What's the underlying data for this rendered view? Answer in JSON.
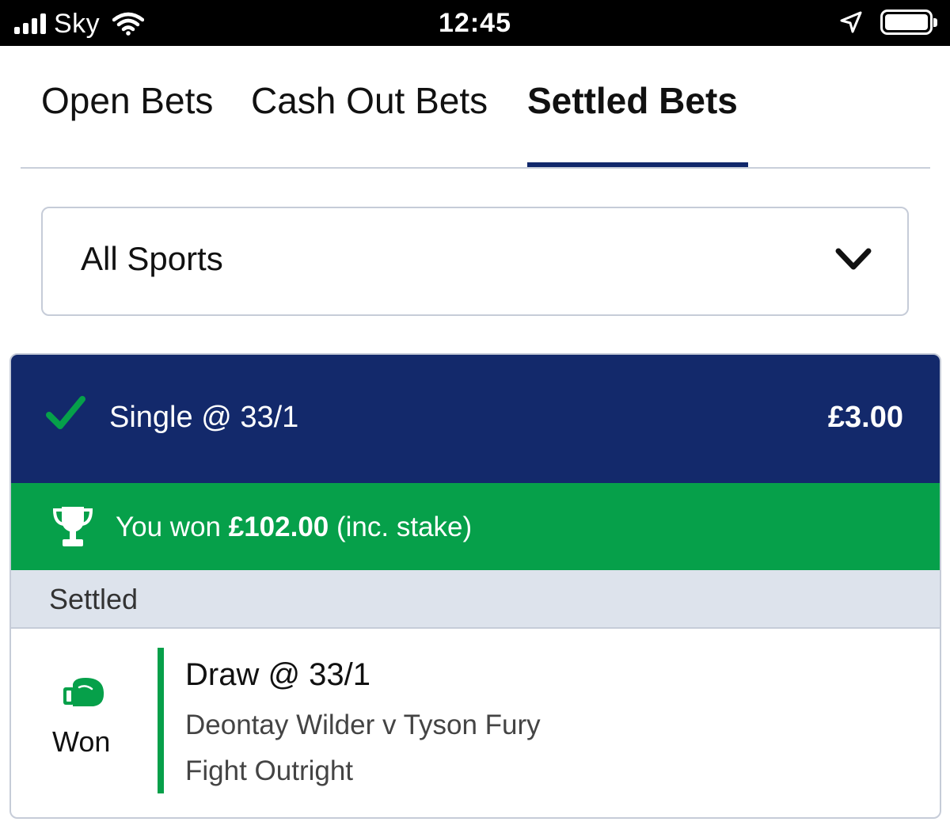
{
  "status_bar": {
    "carrier": "Sky",
    "time": "12:45",
    "icons": [
      "signal-icon",
      "wifi-icon",
      "location-arrow-icon",
      "battery-icon"
    ]
  },
  "tabs": [
    {
      "label": "Open Bets",
      "active": false
    },
    {
      "label": "Cash Out Bets",
      "active": false
    },
    {
      "label": "Settled Bets",
      "active": true
    }
  ],
  "filter": {
    "selected": "All Sports",
    "icon": "chevron-down-icon"
  },
  "bet": {
    "type": "Single @ 33/1",
    "stake": "£3.00",
    "status_icon": "check-icon",
    "winnings": {
      "prefix": "You won",
      "amount": "£102.00",
      "suffix": "(inc. stake)",
      "icon": "trophy-icon"
    },
    "section_label": "Settled",
    "selection": {
      "sport_icon": "boxing-glove-icon",
      "result": "Won",
      "title": "Draw @ 33/1",
      "event": "Deontay Wilder v Tyson Fury",
      "market": "Fight Outright"
    }
  },
  "colors": {
    "header_navy": "#13296b",
    "tab_underline": "#11286b",
    "win_green": "#06a04a",
    "settled_bg": "#dde3ec"
  }
}
